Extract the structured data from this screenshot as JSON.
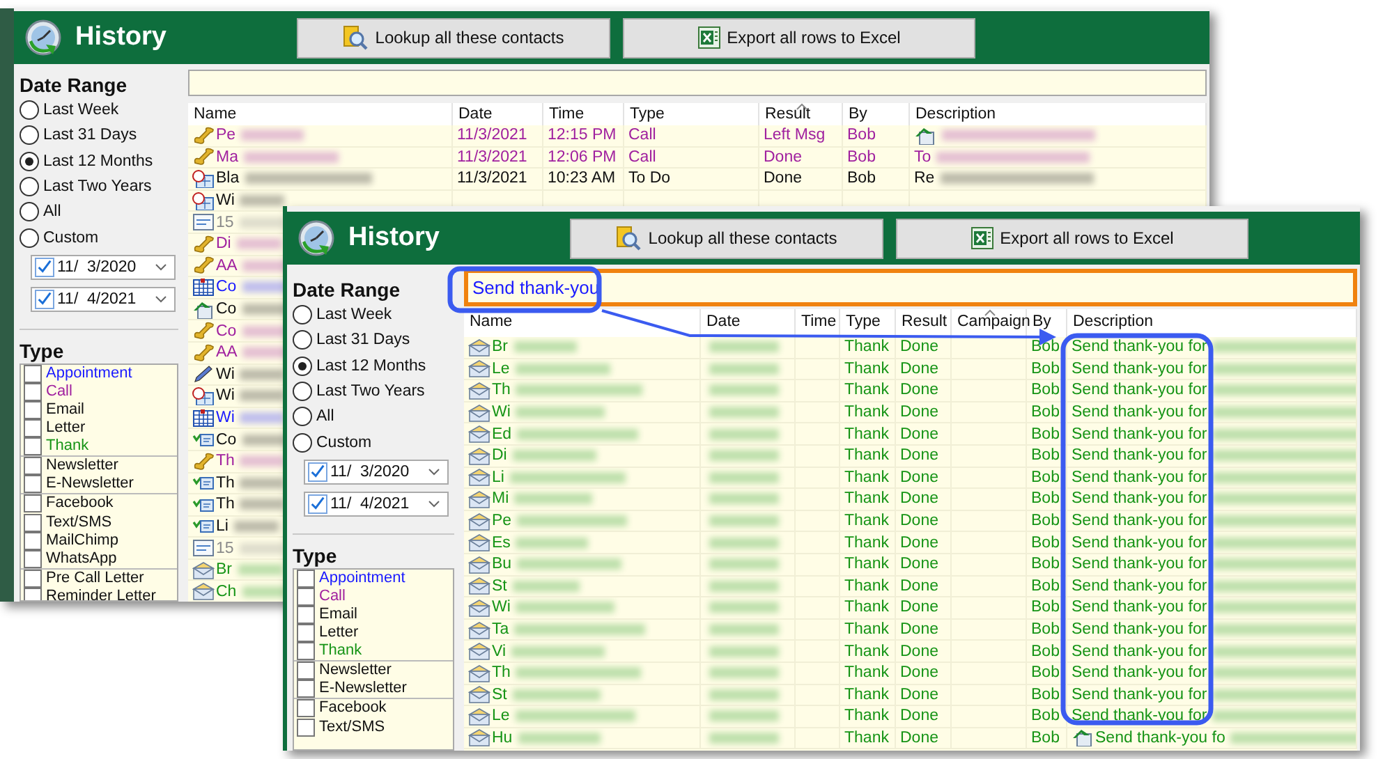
{
  "windows": [
    {
      "title": "History",
      "buttons": [
        {
          "kind": "lookup",
          "label": "Lookup all these contacts"
        },
        {
          "kind": "export",
          "label": "Export all rows to Excel"
        }
      ],
      "date_range": {
        "heading": "Date Range",
        "options": [
          {
            "label": "Last Week",
            "selected": false
          },
          {
            "label": "Last 31 Days",
            "selected": false
          },
          {
            "label": "Last 12 Months",
            "selected": true
          },
          {
            "label": "Last Two Years",
            "selected": false
          },
          {
            "label": "All",
            "selected": false
          },
          {
            "label": "Custom",
            "selected": false
          }
        ],
        "pickers": [
          {
            "value": "11/  3/2020",
            "checked": true
          },
          {
            "value": "11/  4/2021",
            "checked": true
          }
        ]
      },
      "type_filter": {
        "heading": "Type",
        "items": [
          {
            "label": "Appointment",
            "checked": false,
            "color": "#1a1aff",
            "separator_before": false
          },
          {
            "label": "Call",
            "checked": false,
            "color": "#a0209f",
            "separator_before": false
          },
          {
            "label": "Email",
            "checked": false,
            "color": "#111111",
            "separator_before": false
          },
          {
            "label": "Letter",
            "checked": false,
            "color": "#111111",
            "separator_before": false
          },
          {
            "label": "Thank",
            "checked": false,
            "color": "#169416",
            "separator_before": false
          },
          {
            "label": "Newsletter",
            "checked": false,
            "color": "#111111",
            "separator_before": true
          },
          {
            "label": "E-Newsletter",
            "checked": false,
            "color": "#111111",
            "separator_before": false
          },
          {
            "label": "Facebook",
            "checked": false,
            "color": "#111111",
            "separator_before": true
          },
          {
            "label": "Text/SMS",
            "checked": false,
            "color": "#111111",
            "separator_before": false
          },
          {
            "label": "MailChimp",
            "checked": false,
            "color": "#111111",
            "separator_before": false
          },
          {
            "label": "WhatsApp",
            "checked": false,
            "color": "#111111",
            "separator_before": false
          },
          {
            "label": "Pre Call Letter",
            "checked": false,
            "color": "#111111",
            "separator_before": true
          },
          {
            "label": "Reminder Letter",
            "checked": false,
            "color": "#111111",
            "separator_before": false
          }
        ]
      },
      "search": {
        "focused": false
      },
      "table": {
        "blurred_dates": false,
        "columns": [
          {
            "label": "Name",
            "sorted": false
          },
          {
            "label": "Date",
            "sorted": false
          },
          {
            "label": "Time",
            "sorted": false
          },
          {
            "label": "Type",
            "sorted": false
          },
          {
            "label": "Result",
            "sorted": true
          },
          {
            "label": "By",
            "sorted": false
          },
          {
            "label": "Description",
            "sorted": false
          }
        ],
        "rows": [
          {
            "kind": "call",
            "name": "Pe",
            "date": "11/3/2021",
            "time": "12:15 PM",
            "type": "Call",
            "result": "Left Msg",
            "by": "Bob",
            "note_icon": true
          },
          {
            "kind": "call",
            "name": "Ma",
            "date": "11/3/2021",
            "time": "12:06 PM",
            "type": "Call",
            "result": "Done",
            "by": "Bob",
            "description": "To"
          },
          {
            "kind": "todo",
            "name": "Bla",
            "date": "11/3/2021",
            "time": "10:23 AM",
            "type": "To Do",
            "result": "Done",
            "by": "Bob",
            "description": "Re"
          },
          {
            "kind": "todo",
            "name": "Wi"
          },
          {
            "kind": "note",
            "name": "15"
          },
          {
            "kind": "call",
            "name": "Di"
          },
          {
            "kind": "call",
            "name": "AA"
          },
          {
            "kind": "appointment",
            "name": "Co"
          },
          {
            "kind": "task",
            "name": "Co"
          },
          {
            "kind": "call",
            "name": "Co"
          },
          {
            "kind": "call",
            "name": "AA"
          },
          {
            "kind": "edit",
            "name": "Wi"
          },
          {
            "kind": "todo",
            "name": "Wi"
          },
          {
            "kind": "appointment",
            "name": "Wi"
          },
          {
            "kind": "message",
            "name": "Co"
          },
          {
            "kind": "call",
            "name": "Th"
          },
          {
            "kind": "message",
            "name": "Th"
          },
          {
            "kind": "message",
            "name": "Th"
          },
          {
            "kind": "message",
            "name": "Li"
          },
          {
            "kind": "note",
            "name": "15"
          },
          {
            "kind": "thank",
            "name": "Br"
          },
          {
            "kind": "thank",
            "name": "Ch"
          }
        ]
      }
    },
    {
      "title": "History",
      "buttons": [
        {
          "kind": "lookup",
          "label": "Lookup all these contacts"
        },
        {
          "kind": "export",
          "label": "Export all rows to Excel"
        }
      ],
      "date_range": {
        "heading": "Date Range",
        "options": [
          {
            "label": "Last Week",
            "selected": false
          },
          {
            "label": "Last 31 Days",
            "selected": false
          },
          {
            "label": "Last 12 Months",
            "selected": true
          },
          {
            "label": "Last Two Years",
            "selected": false
          },
          {
            "label": "All",
            "selected": false
          },
          {
            "label": "Custom",
            "selected": false
          }
        ],
        "pickers": [
          {
            "value": "11/  3/2020",
            "checked": true
          },
          {
            "value": "11/  4/2021",
            "checked": true
          }
        ]
      },
      "type_filter": {
        "heading": "Type",
        "items": [
          {
            "label": "Appointment",
            "checked": false,
            "color": "#1a1aff",
            "separator_before": false
          },
          {
            "label": "Call",
            "checked": false,
            "color": "#a0209f",
            "separator_before": false
          },
          {
            "label": "Email",
            "checked": false,
            "color": "#111111",
            "separator_before": false
          },
          {
            "label": "Letter",
            "checked": false,
            "color": "#111111",
            "separator_before": false
          },
          {
            "label": "Thank",
            "checked": false,
            "color": "#169416",
            "separator_before": false
          },
          {
            "label": "Newsletter",
            "checked": false,
            "color": "#111111",
            "separator_before": true
          },
          {
            "label": "E-Newsletter",
            "checked": false,
            "color": "#111111",
            "separator_before": false
          },
          {
            "label": "Facebook",
            "checked": false,
            "color": "#111111",
            "separator_before": true
          },
          {
            "label": "Text/SMS",
            "checked": false,
            "color": "#111111",
            "separator_before": false
          }
        ]
      },
      "search": {
        "focused": true,
        "value": "Send thank-you"
      },
      "table": {
        "blurred_dates": true,
        "columns": [
          {
            "label": "Name",
            "sorted": false
          },
          {
            "label": "Date",
            "sorted": false
          },
          {
            "label": "Time",
            "sorted": false
          },
          {
            "label": "Type",
            "sorted": false
          },
          {
            "label": "Result",
            "sorted": false
          },
          {
            "label": "Campaign",
            "sorted": true
          },
          {
            "label": "By",
            "sorted": false
          },
          {
            "label": "Description",
            "sorted": false
          }
        ],
        "rows": [
          {
            "kind": "thank",
            "name": "Br",
            "type": "Thank",
            "result": "Done",
            "by": "Bob",
            "description": "Send thank-you for"
          },
          {
            "kind": "thank",
            "name": "Le",
            "type": "Thank",
            "result": "Done",
            "by": "Bob",
            "description": "Send thank-you for"
          },
          {
            "kind": "thank",
            "name": "Th",
            "type": "Thank",
            "result": "Done",
            "by": "Bob",
            "description": "Send thank-you for"
          },
          {
            "kind": "thank",
            "name": "Wi",
            "type": "Thank",
            "result": "Done",
            "by": "Bob",
            "description": "Send thank-you for"
          },
          {
            "kind": "thank",
            "name": "Ed",
            "type": "Thank",
            "result": "Done",
            "by": "Bob",
            "description": "Send thank-you for"
          },
          {
            "kind": "thank",
            "name": "Di",
            "type": "Thank",
            "result": "Done",
            "by": "Bob",
            "description": "Send thank-you for"
          },
          {
            "kind": "thank",
            "name": "Li",
            "type": "Thank",
            "result": "Done",
            "by": "Bob",
            "description": "Send thank-you for"
          },
          {
            "kind": "thank",
            "name": "Mi",
            "type": "Thank",
            "result": "Done",
            "by": "Bob",
            "description": "Send thank-you for"
          },
          {
            "kind": "thank",
            "name": "Pe",
            "type": "Thank",
            "result": "Done",
            "by": "Bob",
            "description": "Send thank-you for"
          },
          {
            "kind": "thank",
            "name": "Es",
            "type": "Thank",
            "result": "Done",
            "by": "Bob",
            "description": "Send thank-you for"
          },
          {
            "kind": "thank",
            "name": "Bu",
            "type": "Thank",
            "result": "Done",
            "by": "Bob",
            "description": "Send thank-you for"
          },
          {
            "kind": "thank",
            "name": "St",
            "type": "Thank",
            "result": "Done",
            "by": "Bob",
            "description": "Send thank-you for"
          },
          {
            "kind": "thank",
            "name": "Wi",
            "type": "Thank",
            "result": "Done",
            "by": "Bob",
            "description": "Send thank-you for"
          },
          {
            "kind": "thank",
            "name": "Ta",
            "type": "Thank",
            "result": "Done",
            "by": "Bob",
            "description": "Send thank-you for"
          },
          {
            "kind": "thank",
            "name": "Vi",
            "type": "Thank",
            "result": "Done",
            "by": "Bob",
            "description": "Send thank-you for"
          },
          {
            "kind": "thank",
            "name": "Th",
            "type": "Thank",
            "result": "Done",
            "by": "Bob",
            "description": "Send thank-you for"
          },
          {
            "kind": "thank",
            "name": "St",
            "type": "Thank",
            "result": "Done",
            "by": "Bob",
            "description": "Send thank-you for"
          },
          {
            "kind": "thank",
            "name": "Le",
            "type": "Thank",
            "result": "Done",
            "by": "Bob",
            "description": "Send thank-you for"
          },
          {
            "kind": "thank",
            "name": "Hu",
            "type": "Thank",
            "result": "Done",
            "by": "Bob",
            "description": "Send thank-you fo",
            "note_icon": true
          }
        ]
      }
    }
  ]
}
